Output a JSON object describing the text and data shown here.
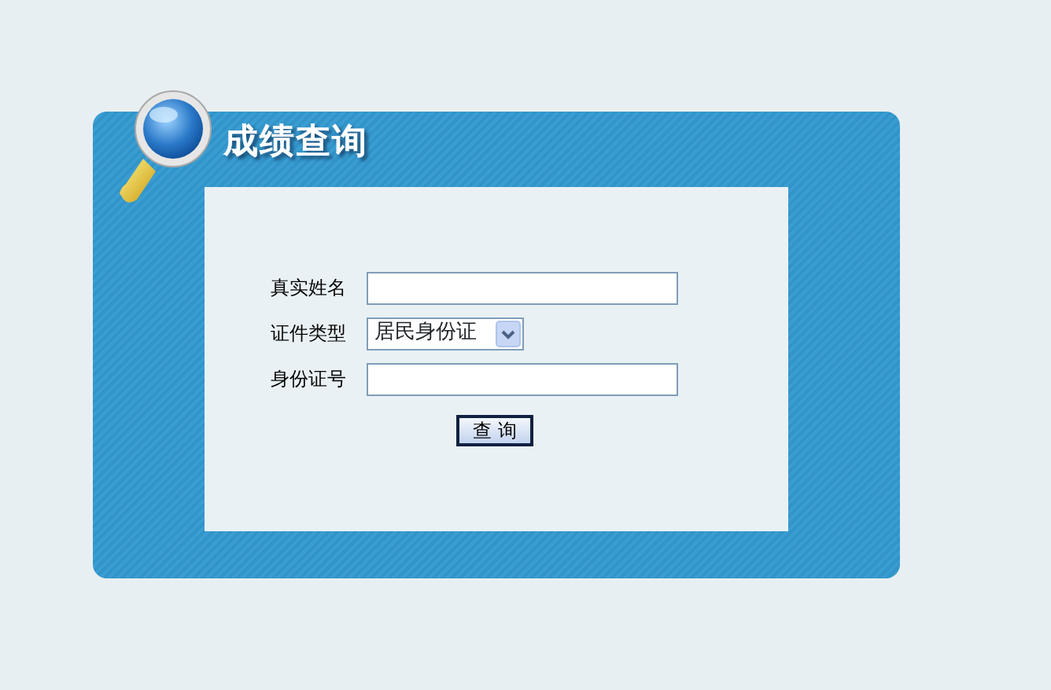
{
  "title": "成绩查询",
  "fields": [
    {
      "label": "真实姓名",
      "kind": "text"
    },
    {
      "label": "证件类型",
      "kind": "select",
      "value": "居民身份证"
    },
    {
      "label": "身份证号",
      "kind": "text"
    }
  ],
  "button": "查 询"
}
